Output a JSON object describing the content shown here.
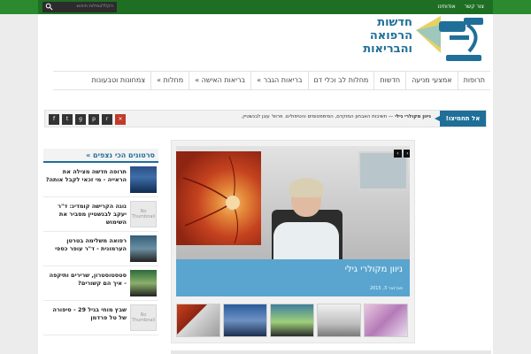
{
  "topbar": {
    "search_placeholder": "הקלד/ומילות חיפוש",
    "links": [
      "צור קשר",
      "אודותינו"
    ]
  },
  "logo": {
    "text_line1": "חדשות",
    "text_line2": "הרפואה",
    "text_line3": "והבריאות",
    "accent_color": "#1f6f98"
  },
  "nav": {
    "items": [
      "תרופות",
      "אמצעי מניעה",
      "חדשות",
      "מחלות לב וכלי דם",
      "בריאות הגבר »",
      "בריאות האישה »",
      "מחלות »",
      "צמחונות וטבעונות"
    ]
  },
  "ticker": {
    "label": "אל תחמיצו!",
    "headline": "ניוון מקולרי גילי",
    "text": " — חשיבות האבחון המוקדם, הסימפטומים והטיפולים. פרופ' עוגן לבנשטיין,",
    "social_icons": [
      "facebook",
      "twitter",
      "google-plus",
      "pinterest",
      "rss",
      "shuffle"
    ]
  },
  "sidebar": {
    "heading": "סרטונים הכי נצפים »",
    "items": [
      {
        "title": "תרופה חדשה מצילה את הראייה - מי זכאי לקבל אותה?",
        "thumb": "image"
      },
      {
        "title": "נוגה הקרישה קומדינ: ד\"ר יעקב לבנשטיין מסביר את השימוש",
        "thumb": "No Thumbnail"
      },
      {
        "title": "רפואה משלימה בטרטן הערמונית - ד\"ר עופר כספי",
        "thumb": "image"
      },
      {
        "title": "סטסטוסטרון, שרירים ותיקפה - איך הם קשורים?",
        "thumb": "image"
      },
      {
        "title": "שבץ מוחי בגיל 29 - סיפורה של טל פרדמן",
        "thumb": "No Thumbnail"
      }
    ]
  },
  "slider": {
    "title": "ניוון מקולרי גילי",
    "date": "פברואר 3, 2015",
    "prev": "‹",
    "next": "›",
    "thumb_count": 5
  },
  "no_thumb_text": "No Thumbnail"
}
